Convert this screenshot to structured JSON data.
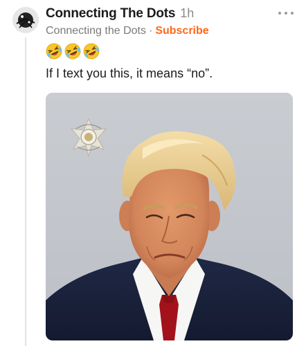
{
  "post": {
    "publication_name": "Connecting The Dots",
    "time_ago": "1h",
    "author": "Connecting the Dots",
    "separator": "·",
    "subscribe_label": "Subscribe",
    "emojis": [
      "rolling-on-floor-laughing-emoji",
      "rolling-on-floor-laughing-emoji",
      "rolling-on-floor-laughing-emoji"
    ],
    "text": "If I text you this, it means “no”.",
    "image": {
      "subject": "mugshot-photo",
      "background_color": "#c5c8cd",
      "badge": "sheriff-badge-icon"
    }
  },
  "colors": {
    "accent": "#ff6719",
    "muted_text": "#7a7a7a",
    "primary_text": "#1b1b1b"
  }
}
